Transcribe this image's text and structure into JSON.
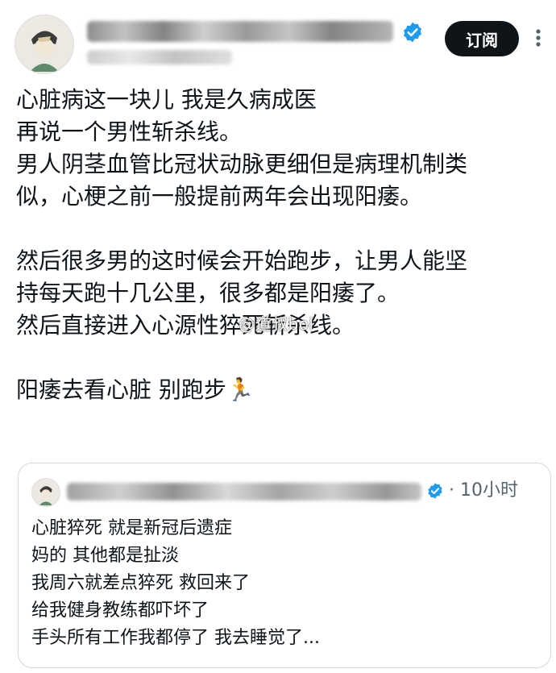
{
  "header": {
    "subscribe_label": "订阅",
    "icons": {
      "verified": "verified-badge-icon",
      "more": "more-dots-icon"
    }
  },
  "post": {
    "lines": [
      "心脏病这一块儿 我是久病成医",
      "再说一个男性斩杀线。",
      "男人阴茎血管比冠状动脉更细但是病理机制类",
      "似，心梗之前一般提前两年会出现阳痿。",
      "",
      "然后很多男的这时候会开始跑步，让男人能坚",
      "持每天跑十几公里，很多都是阳痿了。",
      "然后直接进入心源性猝死斩杀线。",
      "",
      "阳痿去看心脏 别跑步🏃"
    ]
  },
  "watermark": "@道叔bol",
  "quote": {
    "time": "· 10小时",
    "lines": [
      "心脏猝死 就是新冠后遗症",
      "妈的 其他都是扯淡",
      "我周六就差点猝死 救回来了",
      "给我健身教练都吓坏了",
      "手头所有工作我都停了 我去睡觉了..."
    ]
  },
  "colors": {
    "accent_blue": "#1d9bf0",
    "text": "#0f1419",
    "muted": "#536471",
    "border": "#cfd9de"
  }
}
